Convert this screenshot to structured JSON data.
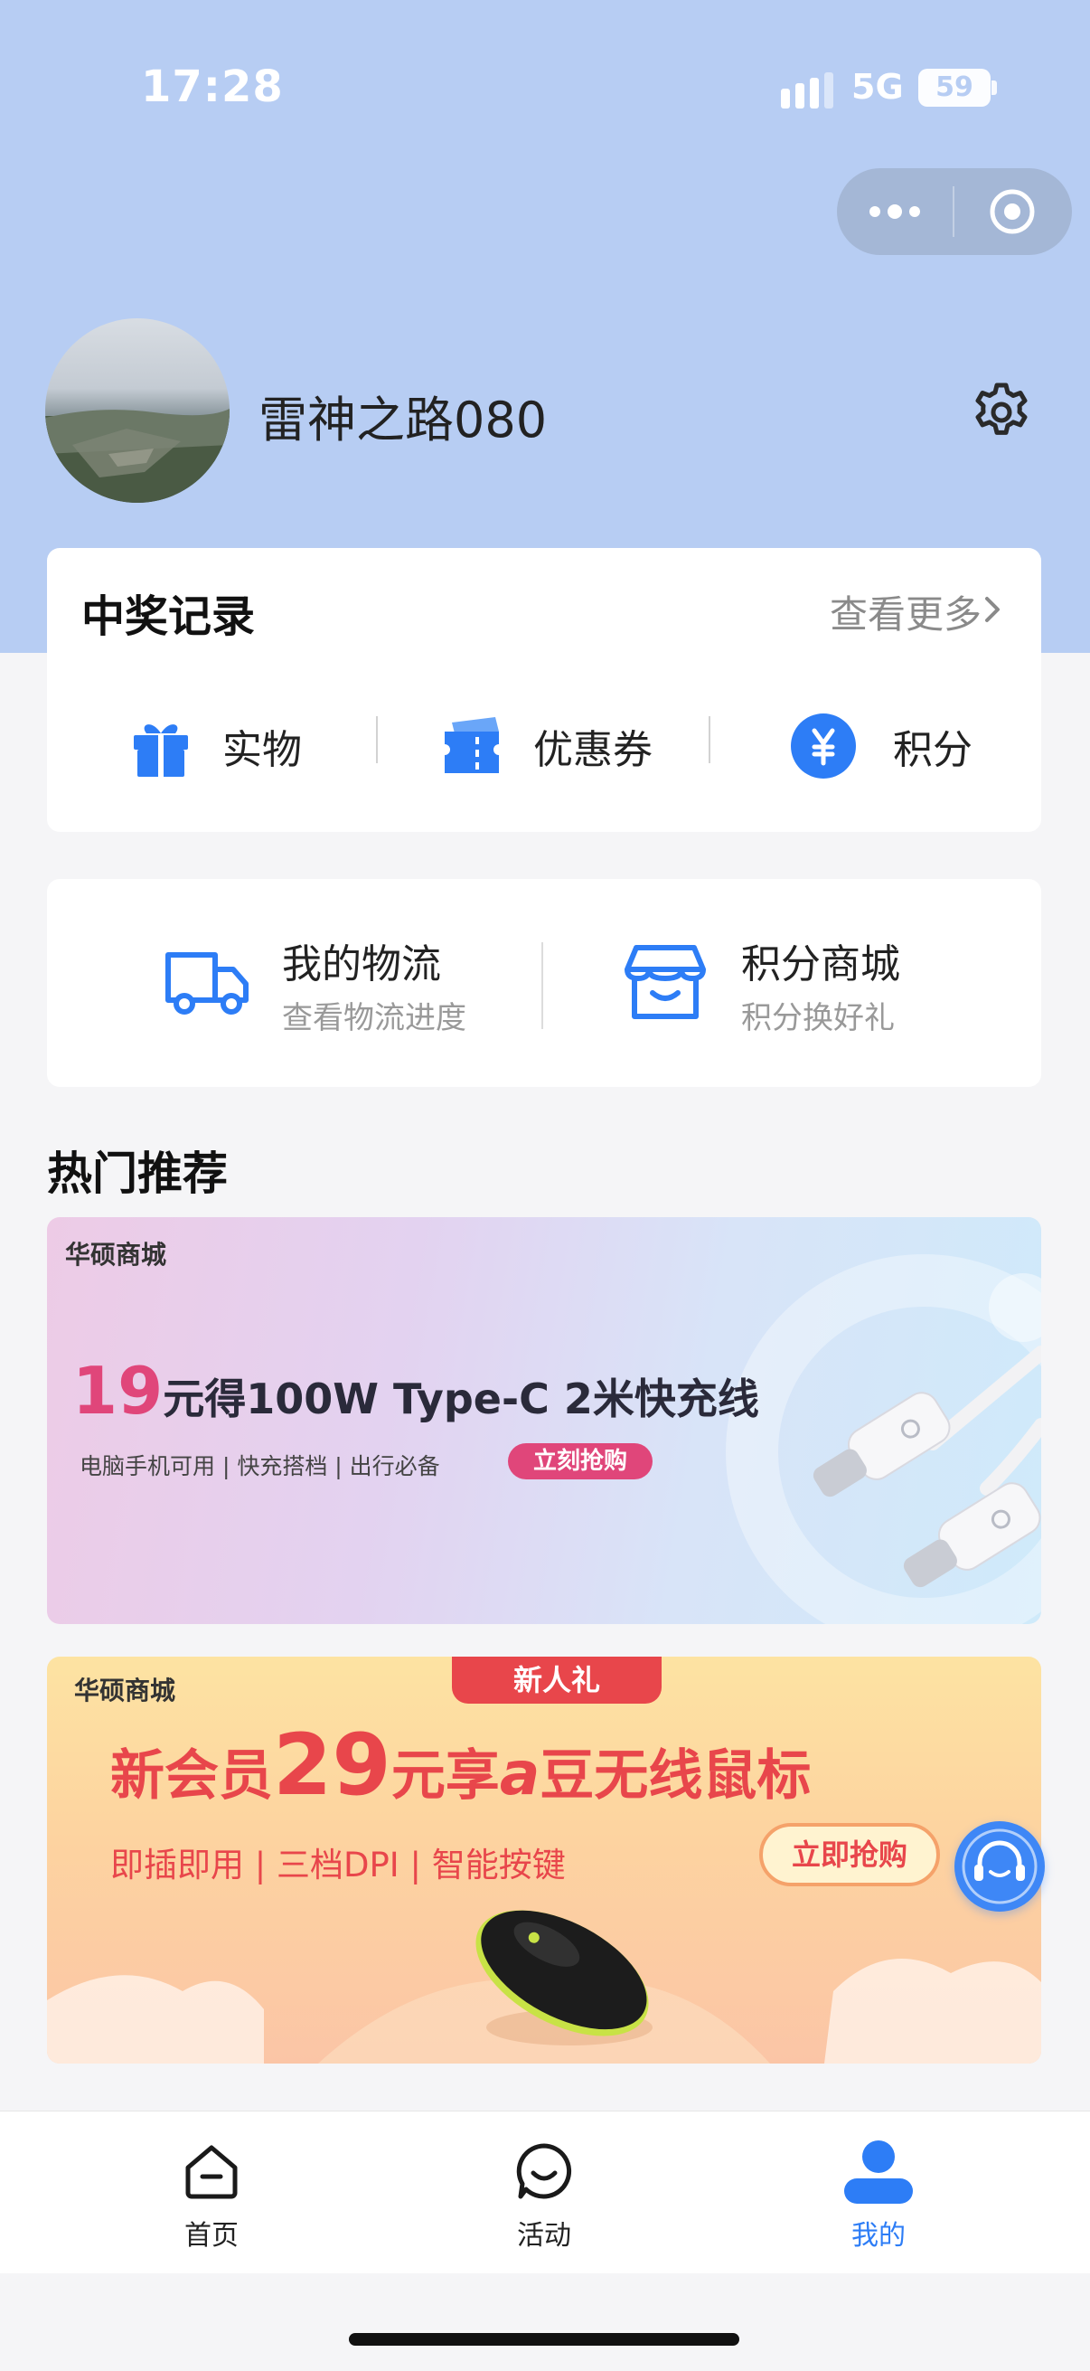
{
  "status_bar": {
    "time": "17:28",
    "network": "5G",
    "battery": "59"
  },
  "profile": {
    "username": "雷神之路080"
  },
  "prize_records": {
    "title": "中奖记录",
    "more_label": "查看更多",
    "items": [
      {
        "label": "实物",
        "icon": "gift-icon"
      },
      {
        "label": "优惠券",
        "icon": "coupon-icon"
      },
      {
        "label": "积分",
        "icon": "yen-points-icon"
      }
    ]
  },
  "services": [
    {
      "title": "我的物流",
      "subtitle": "查看物流进度",
      "icon": "truck-icon"
    },
    {
      "title": "积分商城",
      "subtitle": "积分换好礼",
      "icon": "store-icon"
    }
  ],
  "hot": {
    "title": "热门推荐",
    "banners": [
      {
        "brand": "华硕商城",
        "price": "19",
        "headline": "元得100W Type-C 2米快充线",
        "tagline": "电脑手机可用 | 快充搭档 | 出行必备",
        "cta": "立刻抢购"
      },
      {
        "brand": "华硕商城",
        "badge": "新人礼",
        "prefix": "新会员",
        "price": "29",
        "headline": "元享",
        "headline_logo": "a",
        "headline_suffix": "豆无线鼠标",
        "tagline": "即插即用 | 三档DPI | 智能按键",
        "cta": "立即抢购"
      }
    ]
  },
  "tabbar": {
    "items": [
      {
        "label": "首页",
        "icon": "home-icon"
      },
      {
        "label": "活动",
        "icon": "chat-smile-icon"
      },
      {
        "label": "我的",
        "icon": "person-icon",
        "active": true
      }
    ]
  },
  "colors": {
    "accent": "#2d7df6",
    "hero_bg": "#b7cdf3",
    "banner_price_pink": "#e0467a",
    "banner_red": "#e8464b"
  }
}
